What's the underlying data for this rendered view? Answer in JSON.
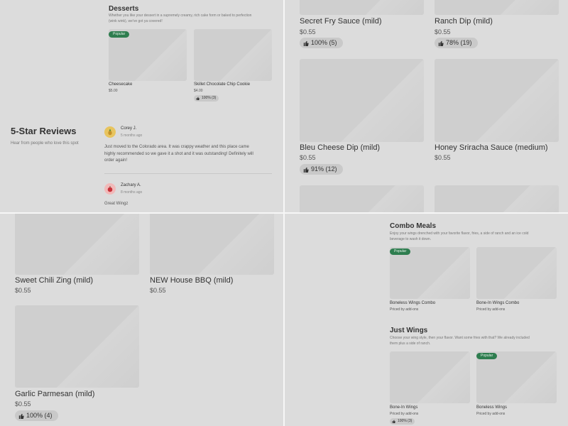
{
  "desserts": {
    "title": "Desserts",
    "description_line1": "Whether you like your dessert in a supremely creamy, rich cake form or baked to perfection",
    "description_line2": "(wink wink), we've got ya covered!",
    "items": [
      {
        "badge": "Popular",
        "name": "Cheesecake",
        "price": "$5.00"
      },
      {
        "name": "Skillet Chocolate Chip Cookie",
        "price": "$4.00",
        "rating": "100% (3)"
      }
    ]
  },
  "reviews": {
    "title": "5-Star Reviews",
    "subtitle": "Hear from people who love this spot",
    "entries": [
      {
        "author": "Corey J.",
        "time": "5 months ago",
        "line1": "Just moved to the Colorado area. It was crappy weather and this place came",
        "line2": "highly recommended so we gave it a shot and it was outstanding! Definitely will",
        "line3": "order again!"
      },
      {
        "author": "Zachary A.",
        "time": "8 months ago",
        "line1": "Great Wingz"
      }
    ]
  },
  "sauces": [
    {
      "name": "Secret Fry Sauce (mild)",
      "price": "$0.55",
      "rating": "100% (5)"
    },
    {
      "name": "Ranch Dip (mild)",
      "price": "$0.55",
      "rating": "78% (19)"
    },
    {
      "name": "Bleu Cheese Dip (mild)",
      "price": "$0.55",
      "rating": "91% (12)"
    },
    {
      "name": "Honey Sriracha Sauce (medium)",
      "price": "$0.55"
    }
  ],
  "flavors": [
    {
      "name": "Sweet Chili Zing (mild)",
      "price": "$0.55"
    },
    {
      "name": "NEW House BBQ (mild)",
      "price": "$0.55"
    },
    {
      "name": "Garlic Parmesan (mild)",
      "price": "$0.55",
      "rating": "100% (4)"
    }
  ],
  "combo_meals": {
    "title": "Combo Meals",
    "description_line1": "Enjoy your wings drenched with your favorite flavor, fries, a side of ranch and an ice cold",
    "description_line2": "beverage to wash it down.",
    "items": [
      {
        "badge": "Popular",
        "name": "Boneless Wings Combo",
        "price": "Priced by add-ons"
      },
      {
        "name": "Bone-In Wings Combo",
        "price": "Priced by add-ons"
      }
    ]
  },
  "just_wings": {
    "title": "Just Wings",
    "description_line1": "Choose your wing style, then your flavor. Want some fries with that? We already included",
    "description_line2": "them plus a side of ranch.",
    "items": [
      {
        "name": "Bone-In Wings",
        "price": "Priced by add-ons",
        "rating": "100% (3)"
      },
      {
        "badge": "Popular",
        "name": "Boneless Wings",
        "price": "Priced by add-ons"
      }
    ]
  },
  "colors": {
    "overlay": "#dcdcdc",
    "badge": "#2e7d4f",
    "placeholder": "#cfcfcf"
  }
}
